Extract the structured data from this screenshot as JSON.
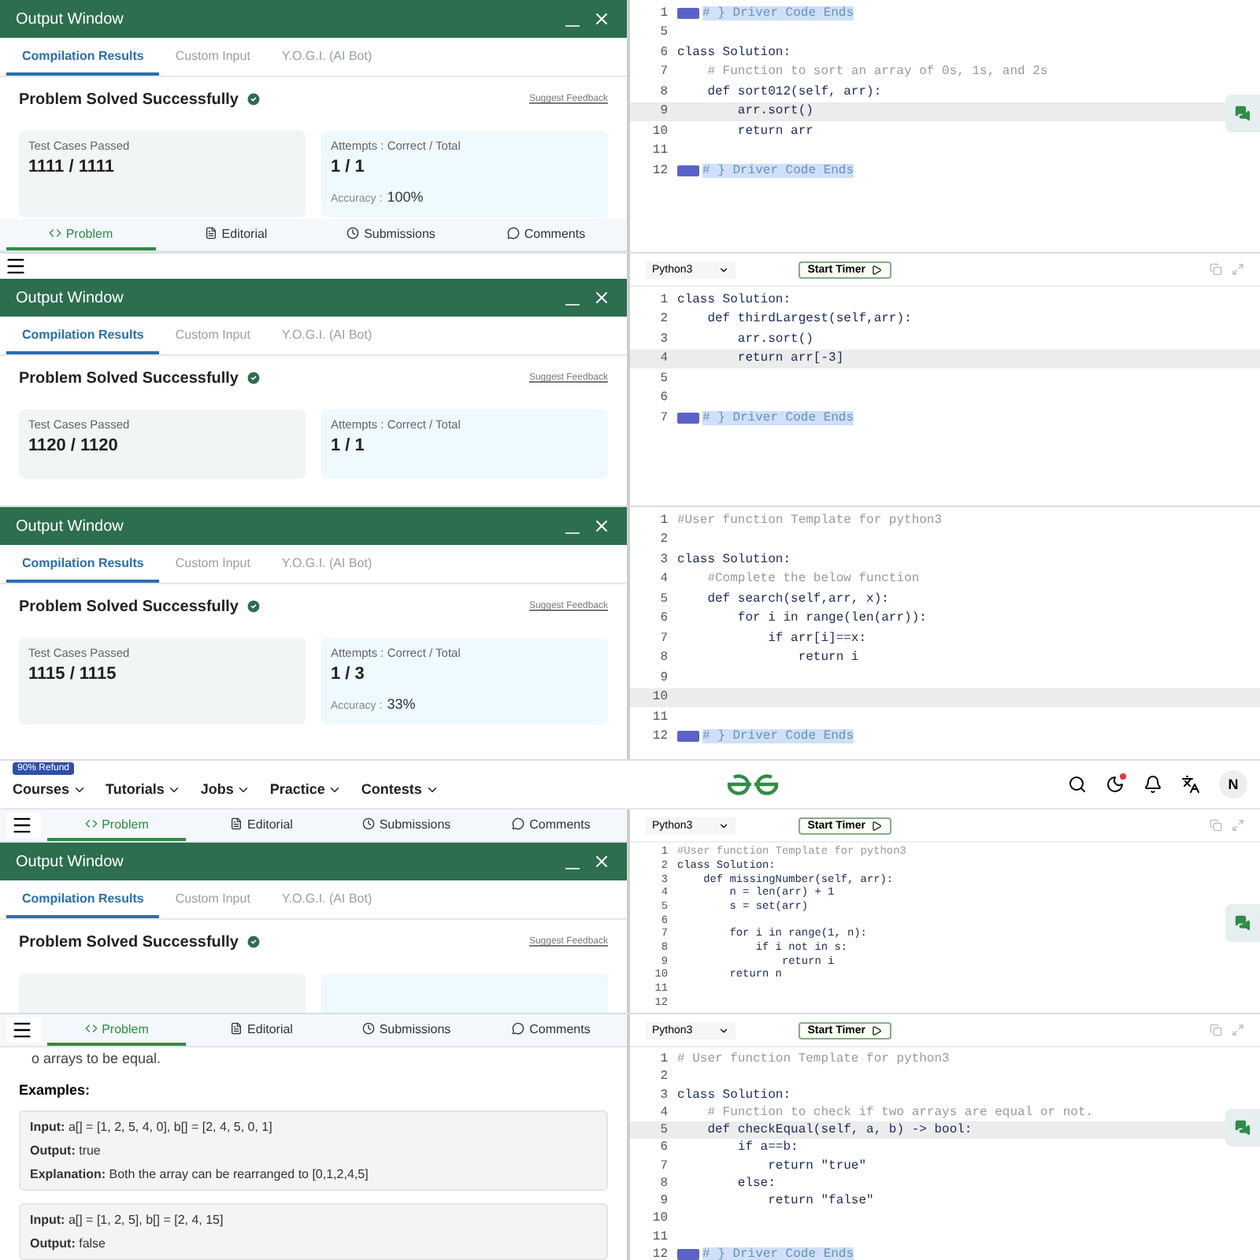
{
  "strips": [
    {
      "left": {
        "kind": "output",
        "window": {
          "title": "Output Window",
          "tabs": [
            {
              "label": "Compilation Results",
              "selected": true
            },
            {
              "label": "Custom Input",
              "selected": false
            },
            {
              "label": "Y.O.G.I. (AI Bot)",
              "selected": false
            }
          ],
          "heading": "Problem Solved Successfully",
          "feedback": "Suggest Feedback",
          "cards": [
            {
              "label": "Test Cases Passed",
              "value": "1111 / 1111"
            },
            {
              "label": "Attempts : Correct / Total",
              "value": "1 / 1",
              "accuracy_label": "Accuracy :",
              "accuracy": "100%"
            }
          ]
        },
        "nav_bottom": [
          {
            "label": "Problem",
            "selected": true
          },
          {
            "label": "Editorial",
            "selected": false
          },
          {
            "label": "Submissions",
            "selected": false
          },
          {
            "label": "Comments",
            "selected": false
          }
        ]
      },
      "right": {
        "chat_button": true,
        "lines": [
          {
            "num": "1",
            "kind": "driver",
            "text": "# } Driver Code Ends",
            "current": false
          },
          {
            "num": "5",
            "kind": "code",
            "current": false
          },
          {
            "num": "6",
            "kind": "code",
            "text": "class Solution:",
            "current": false
          },
          {
            "num": "7",
            "kind": "comment",
            "text": "    # Function to sort an array of 0s, 1s, and 2s",
            "current": false
          },
          {
            "num": "8",
            "kind": "code",
            "text": "    def sort012(self, arr):",
            "current": false
          },
          {
            "num": "9",
            "kind": "code",
            "text": "        arr.sort()",
            "current": true
          },
          {
            "num": "10",
            "kind": "code",
            "text": "        return arr",
            "current": false
          },
          {
            "num": "11",
            "kind": "code",
            "current": false
          },
          {
            "num": "12",
            "kind": "driver",
            "text": "# } Driver Code Ends",
            "current": false
          }
        ]
      }
    },
    {
      "left": {
        "kind": "output",
        "menu": true,
        "window": {
          "title": "Output Window",
          "tabs": [
            {
              "label": "Compilation Results",
              "selected": true
            },
            {
              "label": "Custom Input",
              "selected": false
            },
            {
              "label": "Y.O.G.I. (AI Bot)",
              "selected": false
            }
          ],
          "heading": "Problem Solved Successfully",
          "feedback": "Suggest Feedback",
          "cards": [
            {
              "label": "Test Cases Passed",
              "value": "1120 / 1120"
            },
            {
              "label": "Attempts : Correct / Total",
              "value": "1 / 1"
            }
          ]
        }
      },
      "right": {
        "toolbar": {
          "language": "Python3",
          "timer": "Start Timer"
        },
        "lines": [
          {
            "num": "1",
            "kind": "code",
            "text": "class Solution:",
            "current": false
          },
          {
            "num": "2",
            "kind": "code",
            "text": "    def thirdLargest(self,arr):",
            "current": false
          },
          {
            "num": "3",
            "kind": "code",
            "text": "        arr.sort()",
            "current": false
          },
          {
            "num": "4",
            "kind": "code",
            "text": "        return arr[-3]",
            "current": true
          },
          {
            "num": "5",
            "kind": "code",
            "current": false
          },
          {
            "num": "6",
            "kind": "code",
            "current": false
          },
          {
            "num": "7",
            "kind": "driver",
            "text": "# } Driver Code Ends",
            "current": false
          }
        ]
      }
    },
    {
      "left": {
        "kind": "output",
        "window": {
          "title": "Output Window",
          "tabs": [
            {
              "label": "Compilation Results",
              "selected": true
            },
            {
              "label": "Custom Input",
              "selected": false
            },
            {
              "label": "Y.O.G.I. (AI Bot)",
              "selected": false
            }
          ],
          "heading": "Problem Solved Successfully",
          "feedback": "Suggest Feedback",
          "cards": [
            {
              "label": "Test Cases Passed",
              "value": "1115 / 1115"
            },
            {
              "label": "Attempts : Correct / Total",
              "value": "1 / 3",
              "accuracy_label": "Accuracy :",
              "accuracy": "33%"
            }
          ]
        }
      },
      "right": {
        "lines": [
          {
            "num": "1",
            "kind": "comment",
            "text": "#User function Template for python3",
            "current": false
          },
          {
            "num": "2",
            "kind": "code",
            "current": false
          },
          {
            "num": "3",
            "kind": "code",
            "text": "class Solution:",
            "current": false
          },
          {
            "num": "4",
            "kind": "comment",
            "text": "    #Complete the below function",
            "current": false
          },
          {
            "num": "5",
            "kind": "code",
            "text": "    def search(self,arr, x):",
            "current": false
          },
          {
            "num": "6",
            "kind": "code",
            "text": "        for i in range(len(arr)):",
            "current": false
          },
          {
            "num": "7",
            "kind": "code",
            "text": "            if arr[i]==x:",
            "current": false
          },
          {
            "num": "8",
            "kind": "code",
            "text": "                return i",
            "current": false
          },
          {
            "num": "9",
            "kind": "code",
            "current": false
          },
          {
            "num": "10",
            "kind": "code",
            "current": true
          },
          {
            "num": "11",
            "kind": "code",
            "current": false
          },
          {
            "num": "12",
            "kind": "driver",
            "text": "# } Driver Code Ends",
            "current": false
          }
        ]
      }
    },
    {
      "site_nav": {
        "badge": "90% Refund",
        "menus": [
          "Courses",
          "Tutorials",
          "Jobs",
          "Practice",
          "Contests"
        ],
        "avatar": "N"
      },
      "left": {
        "kind": "output",
        "nav_top": [
          {
            "label": "Problem",
            "selected": true
          },
          {
            "label": "Editorial",
            "selected": false
          },
          {
            "label": "Submissions",
            "selected": false
          },
          {
            "label": "Comments",
            "selected": false
          }
        ],
        "window": {
          "title": "Output Window",
          "tabs": [
            {
              "label": "Compilation Results",
              "selected": true
            },
            {
              "label": "Custom Input",
              "selected": false
            },
            {
              "label": "Y.O.G.I. (AI Bot)",
              "selected": false
            }
          ],
          "heading": "Problem Solved Successfully",
          "feedback": "Suggest Feedback",
          "cards": [
            {
              "kind": "blank"
            },
            {
              "kind": "blank"
            }
          ]
        }
      },
      "right": {
        "toolbar": {
          "language": "Python3",
          "timer": "Start Timer"
        },
        "chat_button": true,
        "lines": [
          {
            "num": "1",
            "kind": "comment",
            "text": "#User function Template for python3",
            "current": false
          },
          {
            "num": "2",
            "kind": "code",
            "text": "class Solution:",
            "current": false
          },
          {
            "num": "3",
            "kind": "code",
            "text": "    def missingNumber(self, arr):",
            "current": false
          },
          {
            "num": "4",
            "kind": "code",
            "text": "        n = len(arr) + 1",
            "current": false
          },
          {
            "num": "5",
            "kind": "code",
            "text": "        s = set(arr)",
            "current": false
          },
          {
            "num": "6",
            "kind": "code",
            "current": false
          },
          {
            "num": "7",
            "kind": "code",
            "text": "        for i in range(1, n):",
            "current": false
          },
          {
            "num": "8",
            "kind": "code",
            "text": "            if i not in s:",
            "current": false
          },
          {
            "num": "9",
            "kind": "code",
            "text": "                return i",
            "current": false
          },
          {
            "num": "10",
            "kind": "code",
            "text": "        return n",
            "current": false
          },
          {
            "num": "11",
            "kind": "code",
            "current": false
          },
          {
            "num": "12",
            "kind": "code",
            "current": false
          }
        ]
      }
    },
    {
      "left": {
        "kind": "problem",
        "nav_top": [
          {
            "label": "Problem",
            "selected": true
          },
          {
            "label": "Editorial",
            "selected": false
          },
          {
            "label": "Submissions",
            "selected": false
          },
          {
            "label": "Comments",
            "selected": false
          }
        ],
        "intro": "o arrays to be equal.",
        "examples_title": "Examples:",
        "examples": [
          [
            "**Input:** a[] = [1, 2, 5, 4, 0], b[] = [2, 4, 5, 0, 1]",
            "**Output:** true",
            "**Explanation:** Both the array can be rearranged to [0,1,2,4,5]"
          ],
          [
            "**Input:** a[] = [1, 2, 5], b[] = [2, 4, 15]",
            "**Output:** false"
          ]
        ]
      },
      "right": {
        "toolbar": {
          "language": "Python3",
          "timer": "Start Timer"
        },
        "chat_button": true,
        "lines": [
          {
            "num": "1",
            "kind": "comment",
            "text": "# User function Template for python3",
            "current": false
          },
          {
            "num": "2",
            "kind": "code",
            "current": false
          },
          {
            "num": "3",
            "kind": "code",
            "text": "class Solution:",
            "current": false
          },
          {
            "num": "4",
            "kind": "comment",
            "text": "    # Function to check if two arrays are equal or not.",
            "current": false
          },
          {
            "num": "5",
            "kind": "code",
            "text": "    def checkEqual(self, a, b) -> bool:",
            "current": true
          },
          {
            "num": "6",
            "kind": "code",
            "text": "        if a==b:",
            "current": false
          },
          {
            "num": "7",
            "kind": "code",
            "text": "            return \"true\"",
            "current": false
          },
          {
            "num": "8",
            "kind": "code",
            "text": "        else:",
            "current": false
          },
          {
            "num": "9",
            "kind": "code",
            "text": "            return \"false\"",
            "current": false
          },
          {
            "num": "10",
            "kind": "code",
            "current": false
          },
          {
            "num": "11",
            "kind": "code",
            "current": false
          },
          {
            "num": "12",
            "kind": "driver",
            "text": "# } Driver Code Ends",
            "current": false
          }
        ]
      }
    }
  ]
}
